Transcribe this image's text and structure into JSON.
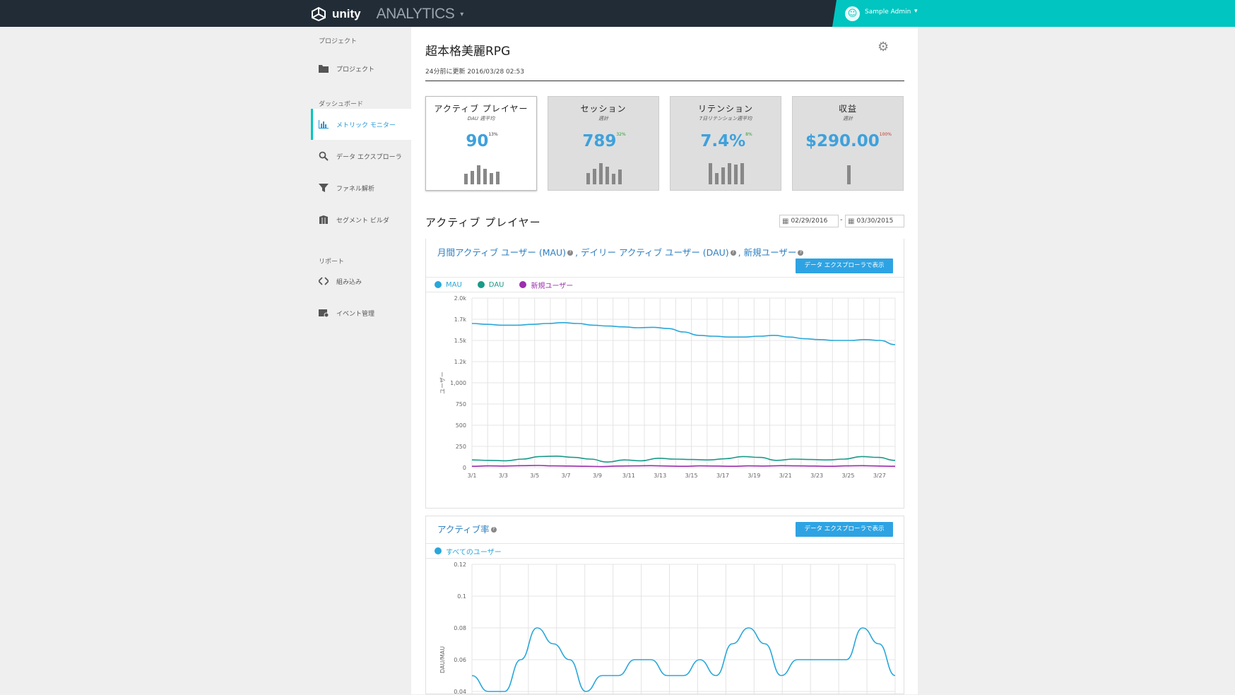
{
  "topbar": {
    "logo": "unity",
    "product": "ANALYTICS",
    "user": "Sample Admin"
  },
  "sidebar": {
    "sections": [
      {
        "label": "プロジェクト",
        "items": [
          {
            "label": "プロジェクト",
            "icon": "folder-icon"
          }
        ]
      },
      {
        "label": "ダッシュボード",
        "items": [
          {
            "label": "メトリック モニター",
            "icon": "bar-chart-icon",
            "active": true
          },
          {
            "label": "データ エクスプローラ",
            "icon": "search-icon"
          },
          {
            "label": "ファネル解析",
            "icon": "funnel-icon"
          },
          {
            "label": "セグメント ビルダ",
            "icon": "segment-icon"
          }
        ]
      },
      {
        "label": "リポート",
        "items": [
          {
            "label": "組み込み",
            "icon": "code-icon"
          },
          {
            "label": "イベント管理",
            "icon": "event-icon"
          }
        ]
      }
    ]
  },
  "header": {
    "title": "超本格美麗RPG",
    "updated": "24分前に更新 2016/03/28 02:53"
  },
  "cards": [
    {
      "title": "アクティブ プレイヤー",
      "subtitle": "DAU 週平均",
      "value": "90",
      "delta": "13%",
      "delta_color": "#333333",
      "bars": [
        0.5,
        0.65,
        0.9,
        0.75,
        0.55,
        0.6
      ],
      "active": true
    },
    {
      "title": "セッション",
      "subtitle": "週計",
      "value": "789",
      "delta": "32%",
      "delta_color": "#2e9e2e",
      "bars": [
        0.55,
        0.75,
        1.0,
        0.85,
        0.5,
        0.7
      ],
      "active": false
    },
    {
      "title": "リテンション",
      "subtitle": "7日リテンション週平均",
      "value": "7.4%",
      "delta": "8%",
      "delta_color": "#2e9e2e",
      "bars": [
        1.0,
        0.55,
        0.8,
        1.0,
        0.95,
        1.0
      ],
      "active": false
    },
    {
      "title": "収益",
      "subtitle": "週計",
      "value": "$290.00",
      "delta": "100%",
      "delta_color": "#c0392b",
      "bars": [
        0.9
      ],
      "active": false
    }
  ],
  "section": {
    "title": "アクティブ プレイヤー",
    "date_from": "02/29/2016",
    "date_to": "03/30/2015",
    "date_sep": "-"
  },
  "panel1": {
    "title_parts": [
      "月間アクティブ ユーザー (MAU)",
      ", デイリー アクティブ ユーザー (DAU)",
      ", 新規ユーザー"
    ],
    "button": "データ エクスプローラで表示"
  },
  "panel2": {
    "title": "アクティブ率",
    "button": "データ エクスプローラで表示"
  },
  "chart_data": [
    {
      "type": "line",
      "ylabel": "ユーザー",
      "ylim": [
        0,
        2000
      ],
      "y_ticks": [
        0,
        250,
        500,
        750,
        1000,
        1250,
        1500,
        1750,
        2000
      ],
      "y_tick_labels": [
        "0",
        "250",
        "500",
        "750",
        "1,000",
        "1.2k",
        "1.5k",
        "1.7k",
        "2.0k"
      ],
      "x_tick_labels": [
        "3/1",
        "3/3",
        "3/5",
        "3/7",
        "3/9",
        "3/11",
        "3/13",
        "3/15",
        "3/17",
        "3/19",
        "3/21",
        "3/23",
        "3/25",
        "3/27"
      ],
      "x_days": [
        1,
        28
      ],
      "grid": true,
      "series": [
        {
          "name": "MAU",
          "color": "#29a7d9",
          "values": [
            1700,
            1690,
            1680,
            1680,
            1690,
            1700,
            1710,
            1700,
            1680,
            1670,
            1660,
            1650,
            1655,
            1640,
            1600,
            1560,
            1550,
            1540,
            1540,
            1550,
            1560,
            1540,
            1520,
            1510,
            1500,
            1500,
            1510,
            1500,
            1450
          ]
        },
        {
          "name": "DAU",
          "color": "#1a9a89",
          "values": [
            90,
            85,
            80,
            100,
            130,
            135,
            120,
            100,
            65,
            90,
            80,
            110,
            100,
            95,
            90,
            105,
            130,
            120,
            85,
            100,
            95,
            90,
            100,
            130,
            120,
            85
          ]
        },
        {
          "name": "新規ユーザー",
          "color": "#9b2fae",
          "values": [
            15,
            20,
            18,
            22,
            25,
            20,
            18,
            15,
            12,
            18,
            20,
            22,
            18,
            15,
            20,
            18,
            15,
            20,
            18,
            22,
            20,
            18,
            15,
            20,
            22,
            18,
            15
          ]
        }
      ]
    },
    {
      "type": "line",
      "ylabel": "DAU/MAU",
      "y_ticks": [
        0.04,
        0.06,
        0.08,
        0.1,
        0.12
      ],
      "y_tick_labels": [
        "0.04",
        "0.06",
        "0.08",
        "0.1",
        "0.12"
      ],
      "ylim": [
        0.04,
        0.12
      ],
      "grid": true,
      "series": [
        {
          "name": "すべてのユーザー",
          "color": "#29a7d9",
          "values": [
            0.05,
            0.04,
            0.04,
            0.06,
            0.08,
            0.07,
            0.06,
            0.04,
            0.05,
            0.05,
            0.06,
            0.06,
            0.05,
            0.05,
            0.06,
            0.05,
            0.07,
            0.08,
            0.07,
            0.05,
            0.06,
            0.06,
            0.06,
            0.06,
            0.08,
            0.07,
            0.05
          ]
        }
      ]
    }
  ]
}
